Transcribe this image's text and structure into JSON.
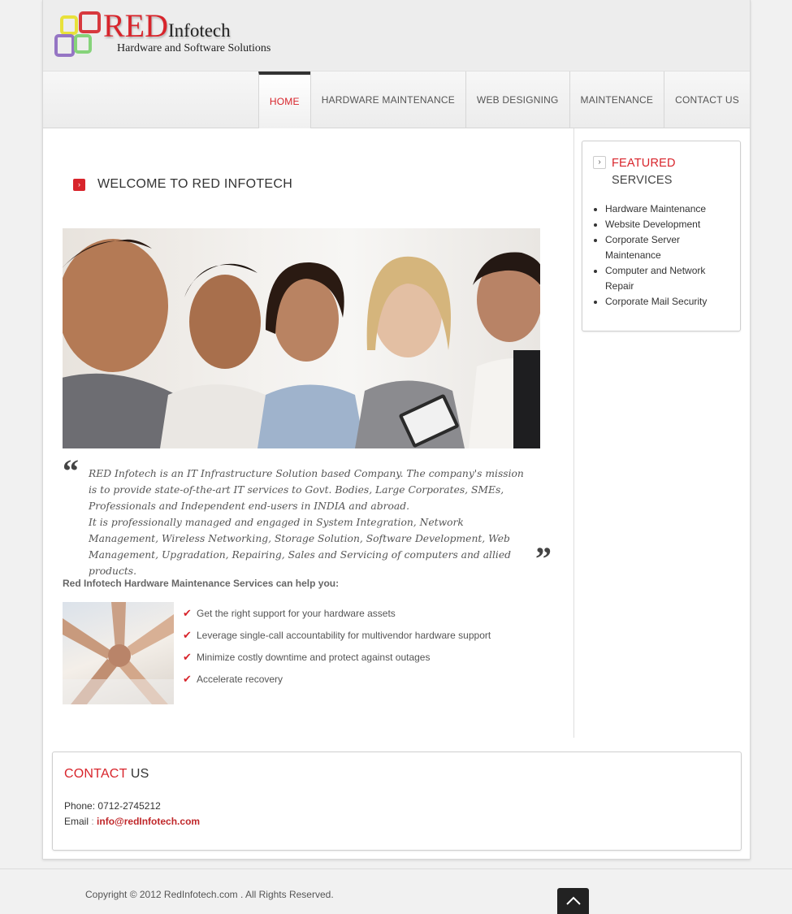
{
  "brand": {
    "name_red": "RED",
    "name_rest": "Infotech",
    "tagline": "Hardware and Software Solutions"
  },
  "nav": {
    "items": [
      {
        "label": "HOME",
        "active": true
      },
      {
        "label": "HARDWARE MAINTENANCE",
        "active": false
      },
      {
        "label": "WEB DESIGNING",
        "active": false
      },
      {
        "label": "MAINTENANCE",
        "active": false
      },
      {
        "label": "CONTACT US",
        "active": false
      }
    ]
  },
  "welcome": {
    "title": "WELCOME TO RED INFOTECH"
  },
  "quote": {
    "open_mark": "“",
    "close_mark": "”",
    "text": "RED Infotech is an IT Infrastructure Solution based Company. The company's mission is to provide state-of-the-art IT services to Govt. Bodies, Large Corporates, SMEs, Professionals and Independent end-users in INDIA and abroad.\nIt is professionally managed and engaged in System Integration, Network Management, Wireless Networking, Storage Solution, Software Development, Web Management, Upgradation, Repairing, Sales and Servicing of computers and allied products."
  },
  "help": {
    "title": "Red Infotech Hardware Maintenance Services can help you:",
    "items": [
      "Get the right support for your hardware assets",
      "Leverage single-call accountability for multivendor hardware support",
      "Minimize costly downtime and protect against outages",
      "Accelerate recovery"
    ]
  },
  "sidebar": {
    "title_red": "FEATURED",
    "title_dark": "SERVICES",
    "items": [
      "Hardware Maintenance",
      "Website Development",
      "Corporate Server Maintenance",
      "Computer and Network Repair",
      "Corporate Mail Security"
    ]
  },
  "contact": {
    "title_red": "CONTACT",
    "title_dark": " US",
    "phone_label": "Phone:",
    "phone_value": "0712-2745212",
    "email_label": "Email",
    "email_sep": " : ",
    "email_value": "info@redInfotech.com"
  },
  "footer": {
    "copyright": "Copyright © 2012 RedInfotech.com . All Rights Reserved."
  },
  "colors": {
    "accent": "#d8242b",
    "text": "#444444",
    "nav_bg": "#efefef"
  },
  "icons": {
    "welcome_bullet": "chevron-right-icon",
    "sidebar_arrow": "chevron-right-icon",
    "check": "check-icon",
    "to_top": "chevron-up-icon"
  }
}
